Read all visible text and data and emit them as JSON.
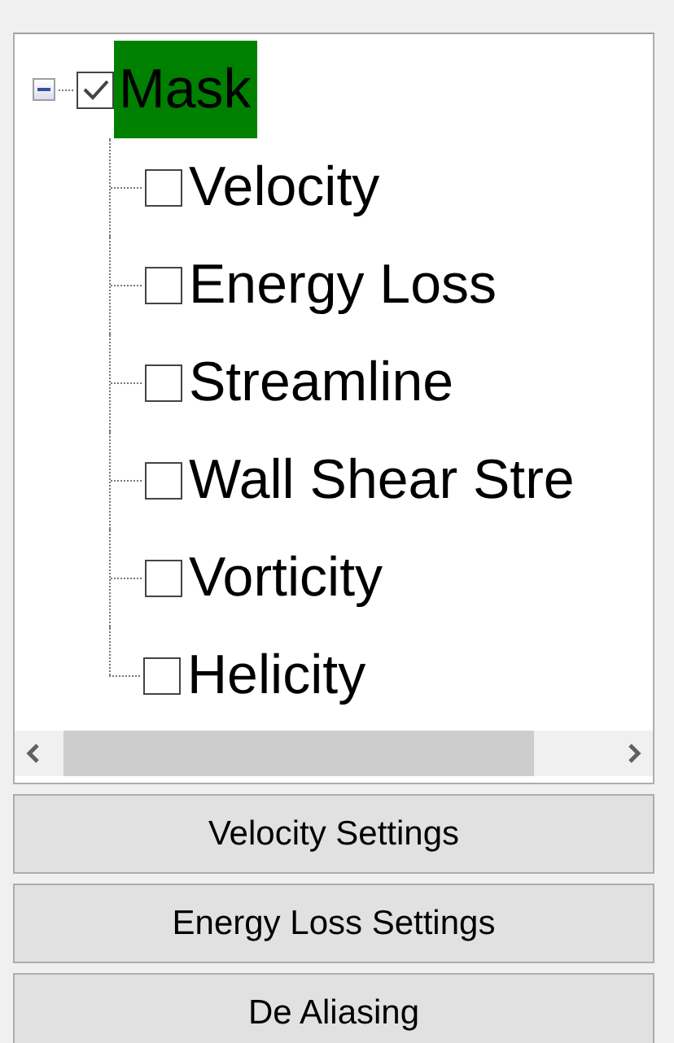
{
  "tree": {
    "label": "Mask",
    "checked": true,
    "expanded": true,
    "selected": true,
    "children": [
      {
        "label": "Velocity",
        "checked": false
      },
      {
        "label": "Energy Loss",
        "checked": false
      },
      {
        "label": "Streamline",
        "checked": false
      },
      {
        "label": "Wall Shear Stre",
        "checked": false
      },
      {
        "label": "Vorticity",
        "checked": false
      },
      {
        "label": "Helicity",
        "checked": false
      }
    ]
  },
  "buttons": [
    "Velocity Settings",
    "Energy Loss Settings",
    "De Aliasing"
  ]
}
